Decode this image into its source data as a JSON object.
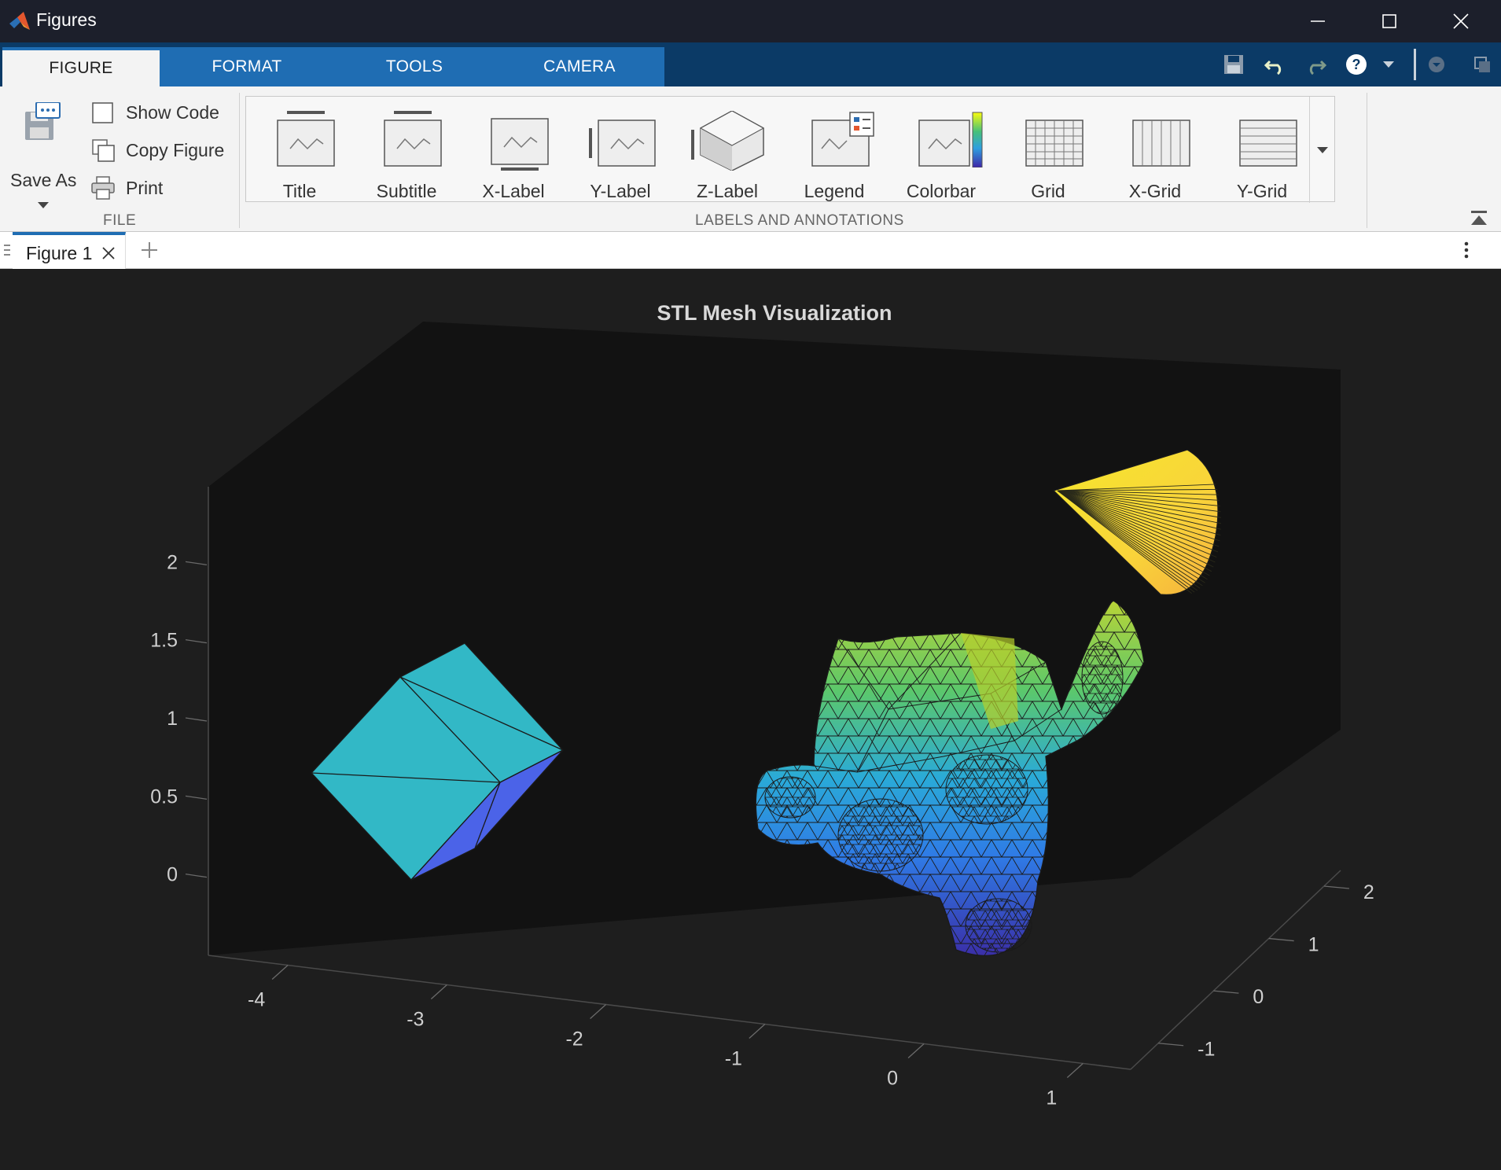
{
  "window": {
    "title": "Figures"
  },
  "tabs": [
    {
      "label": "FIGURE",
      "active": true
    },
    {
      "label": "FORMAT"
    },
    {
      "label": "TOOLS"
    },
    {
      "label": "CAMERA"
    }
  ],
  "file_section": {
    "save_as": "Save As",
    "show_code": "Show Code",
    "copy_figure": "Copy Figure",
    "print": "Print",
    "label": "FILE"
  },
  "gallery": {
    "label": "LABELS AND ANNOTATIONS",
    "items": [
      "Title",
      "Subtitle",
      "X-Label",
      "Y-Label",
      "Z-Label",
      "Legend",
      "Colorbar",
      "Grid",
      "X-Grid",
      "Y-Grid"
    ]
  },
  "doc_tab": {
    "label": "Figure 1"
  },
  "colors": {
    "accent": "#1f6db3",
    "tabstrip": "#0b3a66",
    "titlebar": "#1c1f2b",
    "figure_bg": "#1e1e1e",
    "axes_bg": "#121212"
  },
  "chart_data": {
    "type": "3d-mesh",
    "title": "STL Mesh Visualization",
    "x_ticks": [
      "-4",
      "-3",
      "-2",
      "-1",
      "0",
      "1"
    ],
    "y_ticks": [
      "-1",
      "0",
      "1",
      "2"
    ],
    "z_ticks": [
      "0",
      "0.5",
      "1",
      "1.5",
      "2"
    ],
    "xlim": [
      -4.5,
      1.3
    ],
    "ylim": [
      -1.5,
      2.3
    ],
    "zlim": [
      -0.5,
      2.5
    ],
    "grid": false,
    "colormap": "parula",
    "objects": [
      "cube",
      "monkey head (Suzanne)",
      "cone"
    ]
  }
}
